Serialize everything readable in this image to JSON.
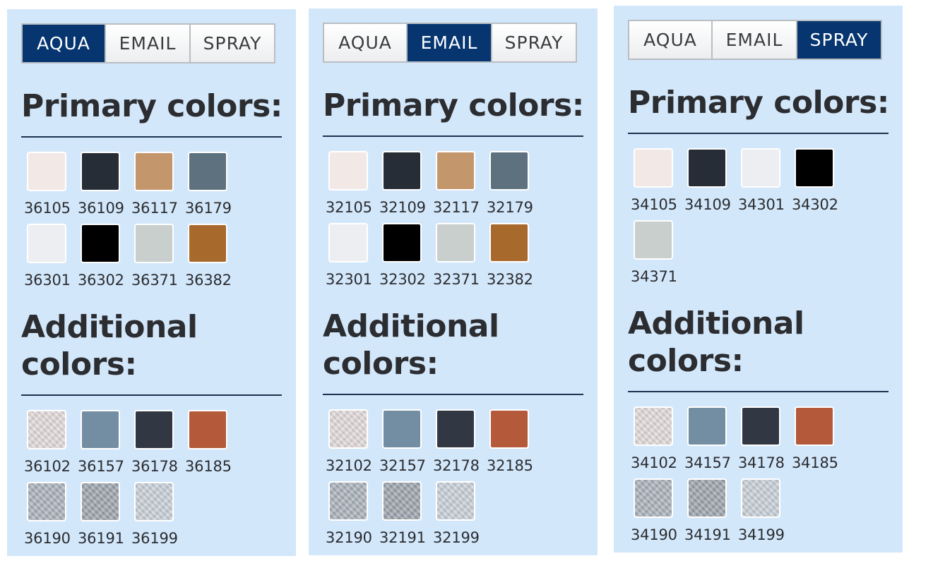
{
  "panels": [
    {
      "tabs": [
        "AQUA",
        "EMAIL",
        "SPRAY"
      ],
      "active_tab": 0,
      "primary_title": "Primary colors:",
      "additional_title": "Additional colors:",
      "primary": [
        {
          "code": "36105",
          "color": "#f2e9e6"
        },
        {
          "code": "36109",
          "color": "#272d36"
        },
        {
          "code": "36117",
          "color": "#c4966c"
        },
        {
          "code": "36179",
          "color": "#5d717f"
        },
        {
          "code": "36301",
          "color": "#eceef1"
        },
        {
          "code": "36302",
          "color": "#000000"
        },
        {
          "code": "36371",
          "color": "#c8cfcc"
        },
        {
          "code": "36382",
          "color": "#a8692c"
        }
      ],
      "additional": [
        {
          "code": "36102",
          "color": "#e0d8d8"
        },
        {
          "code": "36157",
          "color": "#738da3"
        },
        {
          "code": "36178",
          "color": "#323843"
        },
        {
          "code": "36185",
          "color": "#b45a3b"
        },
        {
          "code": "36190",
          "color": "#a8b0b9"
        },
        {
          "code": "36191",
          "color": "#9ba2ab"
        },
        {
          "code": "36199",
          "color": "#c6ced6"
        }
      ]
    },
    {
      "tabs": [
        "AQUA",
        "EMAIL",
        "SPRAY"
      ],
      "active_tab": 1,
      "primary_title": "Primary colors:",
      "additional_title": "Additional colors:",
      "primary": [
        {
          "code": "32105",
          "color": "#f2e9e6"
        },
        {
          "code": "32109",
          "color": "#272d36"
        },
        {
          "code": "32117",
          "color": "#c4966c"
        },
        {
          "code": "32179",
          "color": "#5d717f"
        },
        {
          "code": "32301",
          "color": "#eceef1"
        },
        {
          "code": "32302",
          "color": "#000000"
        },
        {
          "code": "32371",
          "color": "#c8cfcc"
        },
        {
          "code": "32382",
          "color": "#a8692c"
        }
      ],
      "additional": [
        {
          "code": "32102",
          "color": "#e0d8d8"
        },
        {
          "code": "32157",
          "color": "#738da3"
        },
        {
          "code": "32178",
          "color": "#323843"
        },
        {
          "code": "32185",
          "color": "#b45a3b"
        },
        {
          "code": "32190",
          "color": "#a8b0b9"
        },
        {
          "code": "32191",
          "color": "#9ba2ab"
        },
        {
          "code": "32199",
          "color": "#c6ced6"
        }
      ]
    },
    {
      "tabs": [
        "AQUA",
        "EMAIL",
        "SPRAY"
      ],
      "active_tab": 2,
      "primary_title": "Primary colors:",
      "additional_title": "Additional colors:",
      "primary": [
        {
          "code": "34105",
          "color": "#f2e9e6"
        },
        {
          "code": "34109",
          "color": "#272d36"
        },
        {
          "code": "34301",
          "color": "#eceef1"
        },
        {
          "code": "34302",
          "color": "#000000"
        },
        {
          "code": "34371",
          "color": "#c8cfcc"
        }
      ],
      "additional": [
        {
          "code": "34102",
          "color": "#e0d8d8"
        },
        {
          "code": "34157",
          "color": "#738da3"
        },
        {
          "code": "34178",
          "color": "#323843"
        },
        {
          "code": "34185",
          "color": "#b45a3b"
        },
        {
          "code": "34190",
          "color": "#a8b0b9"
        },
        {
          "code": "34191",
          "color": "#9ba2ab"
        },
        {
          "code": "34199",
          "color": "#c6ced6"
        }
      ]
    }
  ],
  "metallic_codes_suffix": [
    "190",
    "191",
    "199",
    "102"
  ]
}
